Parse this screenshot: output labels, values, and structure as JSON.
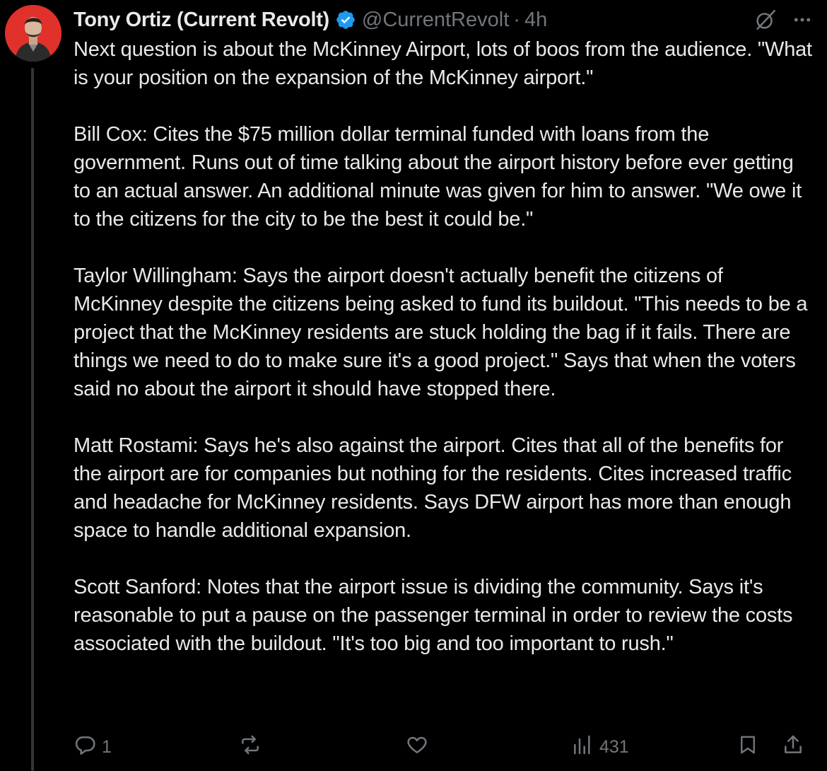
{
  "author": {
    "display_name": "Tony Ortiz (Current Revolt)",
    "handle": "@CurrentRevolt",
    "separator": "·",
    "time": "4h",
    "verified": true,
    "avatar_bg": "#e0312b"
  },
  "post": {
    "paragraphs": [
      "Next question is about the McKinney Airport, lots of boos from the audience. \"What is your position on the expansion of the McKinney airport.\"",
      "Bill Cox: Cites the $75 million dollar terminal funded with loans from the government. Runs out of time talking about the airport history before ever getting to an actual answer. An additional minute was given for him to answer. \"We owe it to the citizens for the city to be the best it could be.\"",
      "Taylor Willingham: Says the airport doesn't actually benefit the citizens of McKinney despite the citizens being asked to fund its buildout. \"This needs to be a project that the McKinney residents are stuck holding the bag if it fails. There are things we need to do to make sure it's a good project.\" Says that when the voters said no about the airport it should have stopped there.",
      "Matt Rostami: Says he's also against the airport. Cites that all of the benefits for the airport are for companies but nothing for the residents. Cites increased traffic and headache for McKinney residents. Says DFW airport has more than enough space to handle additional expansion.",
      "Scott Sanford: Notes that the airport issue is dividing the community. Says it's reasonable to put a pause on the passenger terminal in order to review the costs associated with the buildout. \"It's too big and too important to rush.\""
    ]
  },
  "actions": {
    "reply_count": "1",
    "repost_count": "",
    "like_count": "",
    "views_count": "431"
  },
  "icons": {
    "verified": "verified-badge-icon",
    "grok": "grok-icon",
    "more": "more-icon",
    "reply": "reply-icon",
    "repost": "repost-icon",
    "like": "heart-icon",
    "views": "views-icon",
    "bookmark": "bookmark-icon",
    "share": "share-icon"
  },
  "colors": {
    "background": "#000000",
    "text": "#e7e9ea",
    "muted": "#71767b",
    "verified": "#1d9bf0",
    "thread_line": "#333639"
  }
}
